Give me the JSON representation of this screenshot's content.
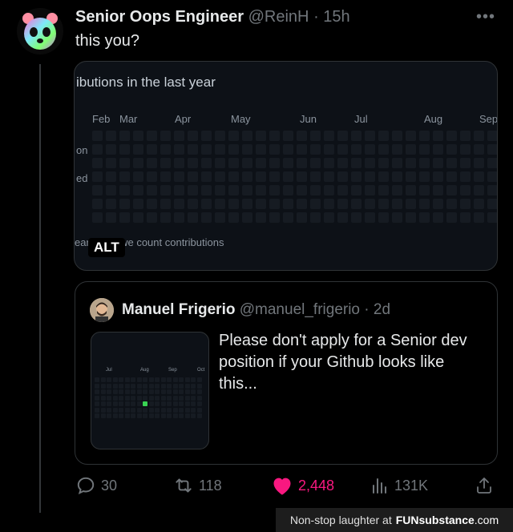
{
  "post": {
    "author_name": "Senior Oops Engineer",
    "author_handle": "@ReinH",
    "separator": "·",
    "time": "15h",
    "text": "this you?",
    "more_icon": "ellipsis-icon"
  },
  "media": {
    "title": "ibutions in the last year",
    "months": [
      "Feb",
      "Mar",
      "Apr",
      "May",
      "Jun",
      "Jul",
      "Aug",
      "Sep"
    ],
    "day_labels": [
      "on",
      "ed"
    ],
    "footer": "earn how we count contributions",
    "alt_badge": "ALT"
  },
  "quote": {
    "author_name": "Manuel Frigerio",
    "author_handle": "@manuel_frigerio",
    "separator": "·",
    "time": "2d",
    "text": "Please don't apply for a Senior dev position if your Github looks like this...",
    "image_months": [
      "Jul",
      "Aug",
      "Sep",
      "Oct"
    ]
  },
  "actions": {
    "replies": "30",
    "reposts": "118",
    "likes": "2,448",
    "views": "131K"
  },
  "watermark": {
    "prefix": "Non-stop laughter at",
    "brand_fun": "FUN",
    "brand_rest": "substance",
    "tld": ".com"
  },
  "colors": {
    "background": "#000000",
    "text_primary": "#e7e9ea",
    "text_secondary": "#71767b",
    "like": "#f91880",
    "contribution_green": "#39d353",
    "contribution_empty": "#161b22"
  }
}
